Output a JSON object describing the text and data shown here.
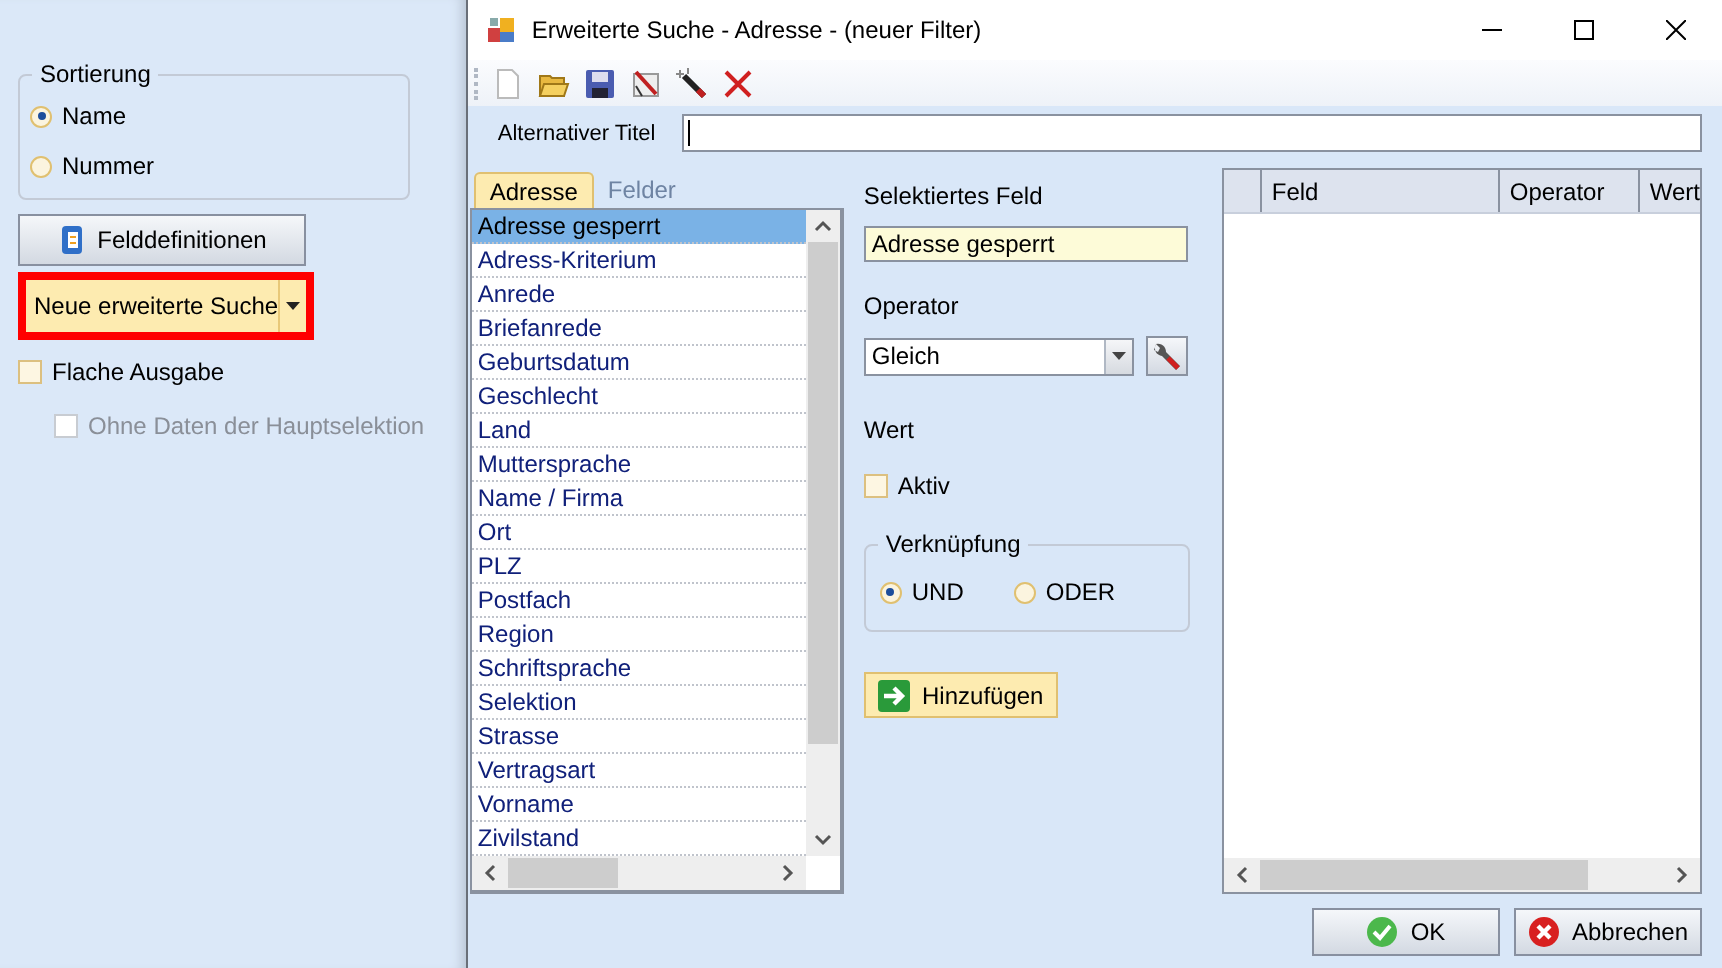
{
  "sidebar": {
    "sort_group": {
      "title": "Sortierung",
      "options": [
        {
          "label": "Name",
          "selected": true
        },
        {
          "label": "Nummer",
          "selected": false
        }
      ]
    },
    "field_definitions_button": "Felddefinitionen",
    "new_search_button": {
      "label": "Neue erweiterte Suche",
      "highlighted": true
    },
    "checkboxes": [
      {
        "label": "Flache Ausgabe",
        "checked": false,
        "disabled": false
      },
      {
        "label": "Ohne Daten der Hauptselektion",
        "checked": false,
        "disabled": true
      }
    ]
  },
  "window": {
    "title": "Erweiterte Suche - Adresse - (neuer Filter)"
  },
  "alt_title": {
    "label": "Alternativer Titel"
  },
  "tabs": [
    {
      "label": "Adresse",
      "selected": true
    },
    {
      "label": "Felder",
      "selected": false
    }
  ],
  "field_list": [
    {
      "label": "Adresse gesperrt",
      "selected": true
    },
    {
      "label": "Adress-Kriterium",
      "selected": false
    },
    {
      "label": "Anrede",
      "selected": false
    },
    {
      "label": "Briefanrede",
      "selected": false
    },
    {
      "label": "Geburtsdatum",
      "selected": false
    },
    {
      "label": "Geschlecht",
      "selected": false
    },
    {
      "label": "Land",
      "selected": false
    },
    {
      "label": "Muttersprache",
      "selected": false
    },
    {
      "label": "Name / Firma",
      "selected": false
    },
    {
      "label": "Ort",
      "selected": false
    },
    {
      "label": "PLZ",
      "selected": false
    },
    {
      "label": "Postfach",
      "selected": false
    },
    {
      "label": "Region",
      "selected": false
    },
    {
      "label": "Schriftsprache",
      "selected": false
    },
    {
      "label": "Selektion",
      "selected": false
    },
    {
      "label": "Strasse",
      "selected": false
    },
    {
      "label": "Vertragsart",
      "selected": false
    },
    {
      "label": "Vorname",
      "selected": false
    },
    {
      "label": "Zivilstand",
      "selected": false
    }
  ],
  "selected_field": {
    "label": "Selektiertes Feld",
    "value": "Adresse gesperrt"
  },
  "operator": {
    "label": "Operator",
    "value": "Gleich"
  },
  "value": {
    "label": "Wert",
    "checkbox": {
      "label": "Aktiv",
      "checked": false
    }
  },
  "link": {
    "title": "Verknüpfung",
    "options": [
      {
        "label": "UND",
        "selected": true
      },
      {
        "label": "ODER",
        "selected": false
      }
    ]
  },
  "add_button": "Hinzufügen",
  "grid": {
    "columns": [
      "Feld",
      "Operator",
      "Wert"
    ]
  },
  "buttons": [
    {
      "label": "OK",
      "kind": "ok"
    },
    {
      "label": "Abbrechen",
      "kind": "cancel"
    }
  ]
}
